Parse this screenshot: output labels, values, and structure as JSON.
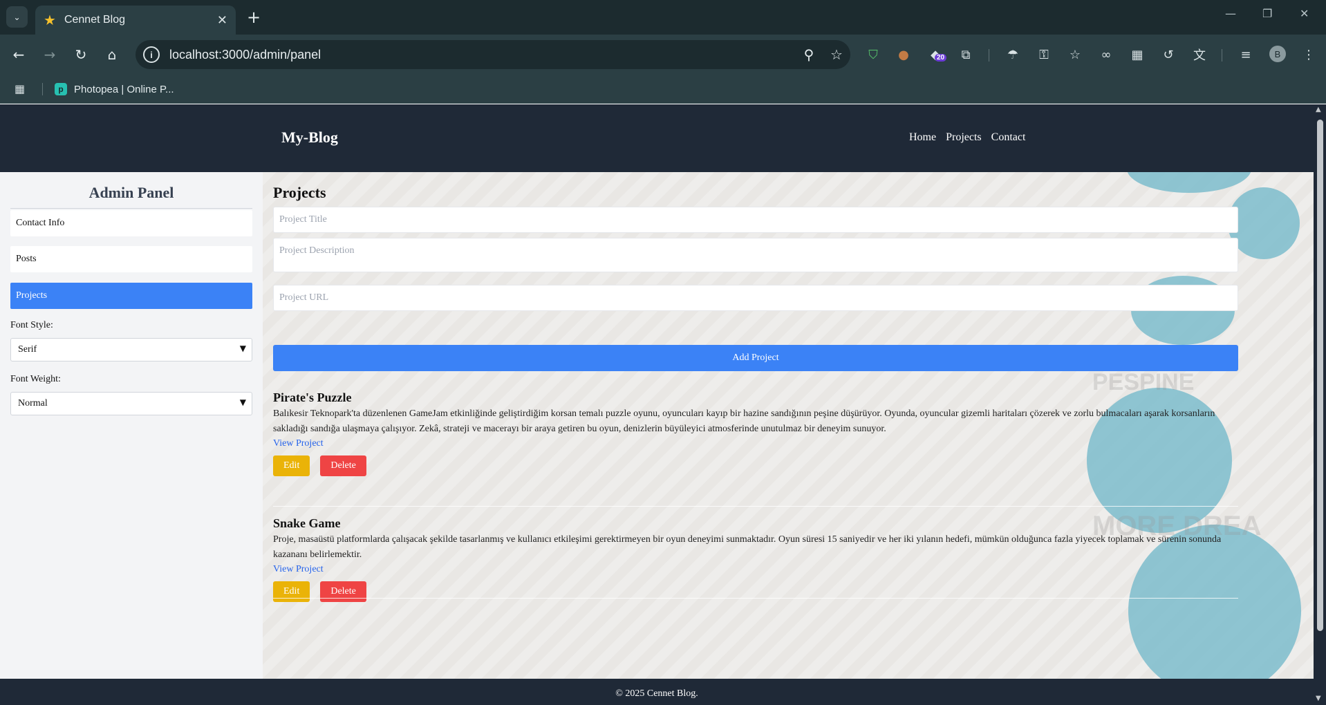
{
  "browser": {
    "tab_title": "Cennet Blog",
    "url": "localhost:3000/admin/panel",
    "ext_badge": "20",
    "profile_initial": "B",
    "bookmark": "Photopea | Online P..."
  },
  "header": {
    "brand": "My-Blog",
    "nav": [
      "Home",
      "Projects",
      "Contact"
    ]
  },
  "sidebar": {
    "title": "Admin Panel",
    "items": [
      "Contact Info",
      "Posts",
      "Projects"
    ],
    "active": "Projects",
    "font_style_label": "Font Style:",
    "font_style_value": "Serif",
    "font_weight_label": "Font Weight:",
    "font_weight_value": "Normal"
  },
  "main": {
    "heading": "Projects",
    "title_placeholder": "Project Title",
    "description_placeholder": "Project Description",
    "url_placeholder": "Project URL",
    "add_button": "Add Project",
    "projects": [
      {
        "title": "Pirate's Puzzle",
        "description": "Balıkesir Teknopark'ta düzenlenen GameJam etkinliğinde geliştirdiğim korsan temalı puzzle oyunu, oyuncuları kayıp bir hazine sandığının peşine düşürüyor. Oyunda, oyuncular gizemli haritaları çözerek ve zorlu bulmacaları aşarak korsanların sakladığı sandığa ulaşmaya çalışıyor. Zekâ, strateji ve macerayı bir araya getiren bu oyun, denizlerin büyüleyici atmosferinde unutulmaz bir deneyim sunuyor.",
        "link": "View Project",
        "edit": "Edit",
        "delete": "Delete"
      },
      {
        "title": "Snake Game",
        "description": "Proje, masaüstü platformlarda çalışacak şekilde tasarlanmış ve kullanıcı etkileşimi gerektirmeyen bir oyun deneyimi sunmaktadır. Oyun süresi 15 saniyedir ve her iki yılanın hedefi, mümkün olduğunca fazla yiyecek toplamak ve sürenin sonunda kazananı belirlemektir.",
        "link": "View Project",
        "edit": "Edit",
        "delete": "Delete"
      }
    ]
  },
  "footer": {
    "text": "© 2025 Cennet Blog."
  },
  "colors": {
    "accent": "#3b82f6",
    "edit": "#eab308",
    "delete": "#ef4444",
    "header_bg": "#1f2937"
  }
}
